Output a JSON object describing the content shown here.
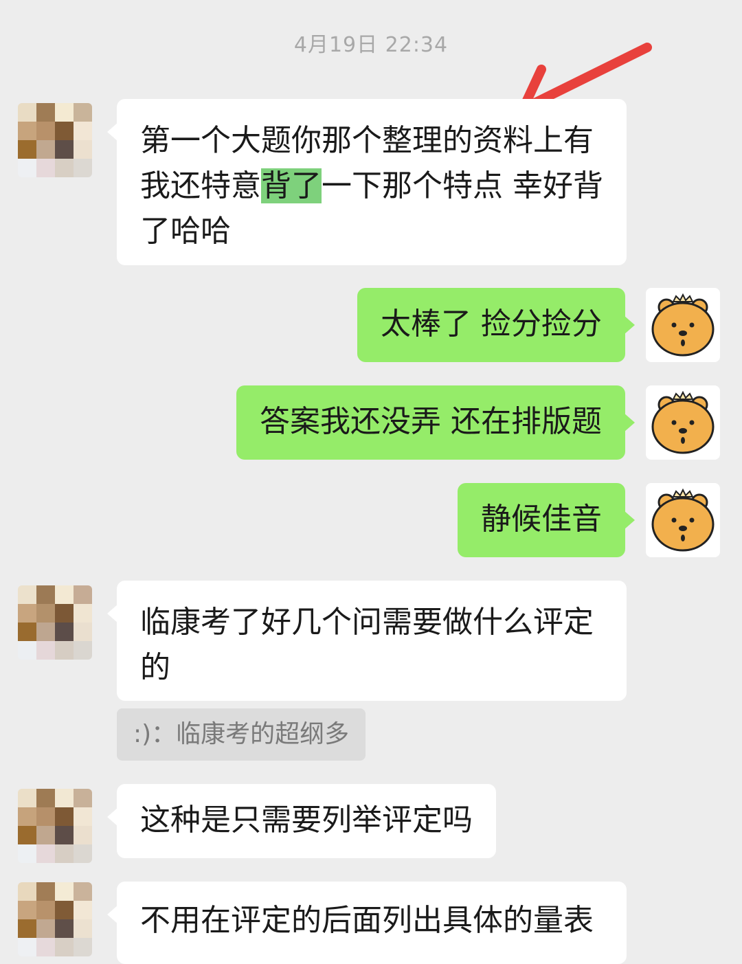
{
  "timestamp": "4月19日 22:34",
  "messages": [
    {
      "side": "left",
      "segments": [
        "第一个大题你那个整理的资料上有 我还特意",
        "背了",
        "一下那个特点 幸好背了哈哈"
      ]
    },
    {
      "side": "right",
      "text": "太棒了 捡分捡分"
    },
    {
      "side": "right",
      "text": "答案我还没弄 还在排版题"
    },
    {
      "side": "right",
      "text": "静候佳音"
    },
    {
      "side": "left",
      "text": "临康考了好几个问需要做什么评定的"
    },
    {
      "side": "left",
      "text": "这种是只需要列举评定吗"
    },
    {
      "side": "left",
      "text": "不用在评定的后面列出具体的量表"
    }
  ],
  "quote": ":)：临康考的超纲多",
  "colors": {
    "background": "#ededed",
    "sent_bubble": "#95ec69",
    "received_bubble": "#ffffff",
    "highlight": "#7ed17c",
    "annotation_arrow": "#e8413c"
  },
  "icons": {
    "self_avatar": "cartoon-bear-avatar",
    "other_avatar": "pixelated-avatar"
  }
}
